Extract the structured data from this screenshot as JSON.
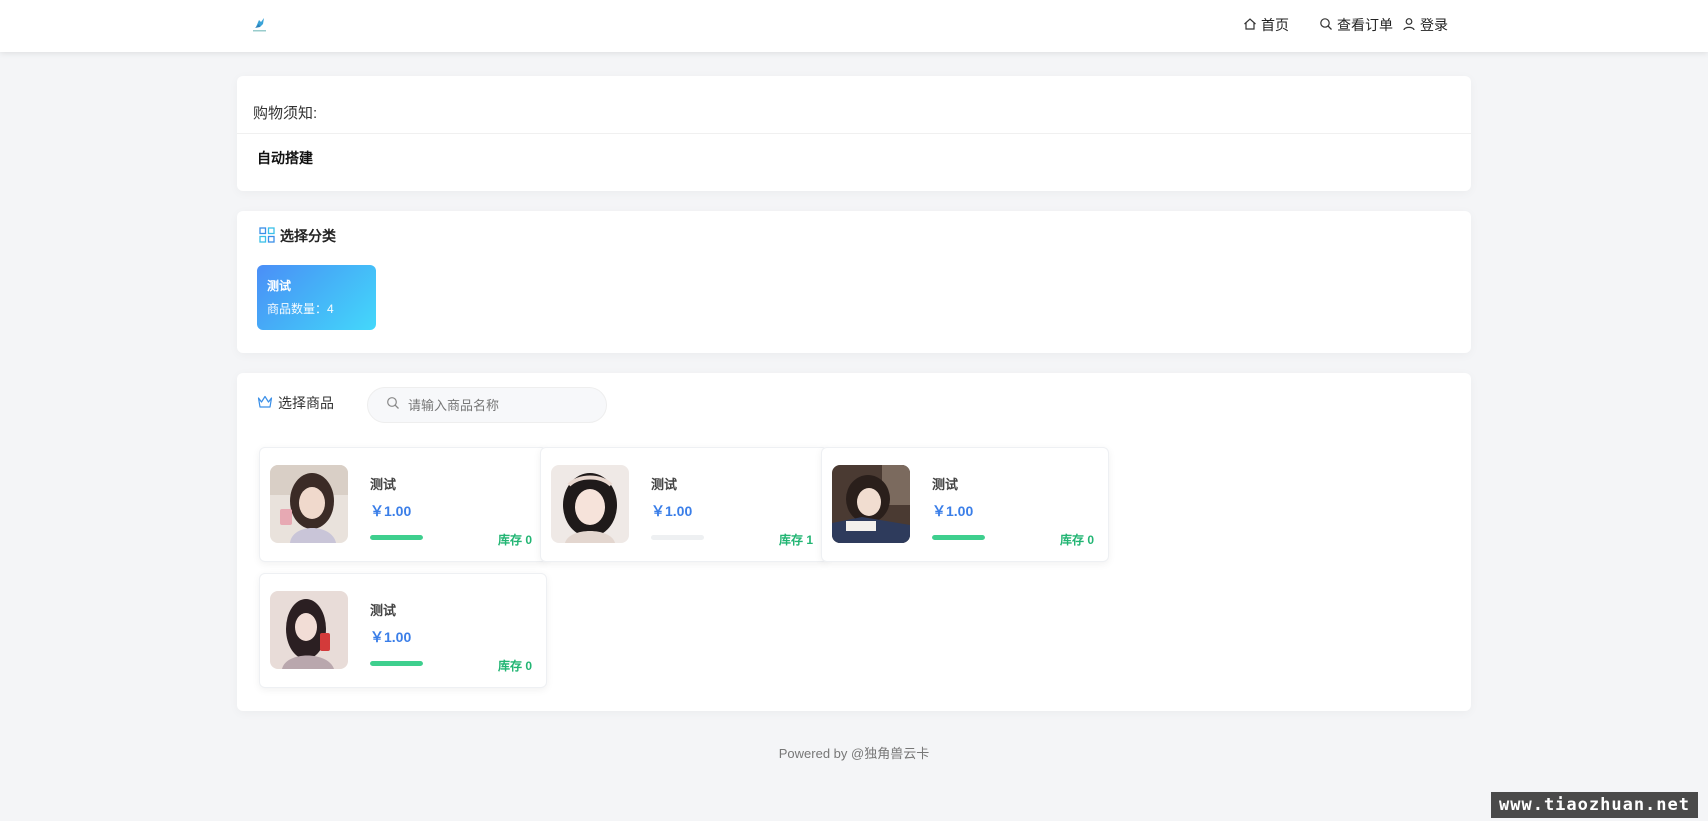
{
  "header": {
    "logo": "unicorn-logo",
    "nav": [
      {
        "label": "首页",
        "icon": "home-icon"
      },
      {
        "label": "查看订单",
        "icon": "search-icon"
      },
      {
        "label": "登录",
        "icon": "user-icon"
      }
    ]
  },
  "notice": {
    "title": "购物须知:",
    "body": "自动搭建"
  },
  "category_section": {
    "title": "选择分类",
    "icon": "grid-icon",
    "categories": [
      {
        "name": "测试",
        "count_label": "商品数量：4"
      }
    ]
  },
  "products_section": {
    "title": "选择商品",
    "icon": "crown-icon",
    "search_placeholder": "请输入商品名称",
    "products": [
      {
        "name": "测试",
        "price": "￥1.00",
        "stock": "库存 0",
        "stock_fill": 1.0
      },
      {
        "name": "测试",
        "price": "￥1.00",
        "stock": "库存 1",
        "stock_fill": 0.0
      },
      {
        "name": "测试",
        "price": "￥1.00",
        "stock": "库存 0",
        "stock_fill": 1.0
      },
      {
        "name": "测试",
        "price": "￥1.00",
        "stock": "库存 0",
        "stock_fill": 1.0
      }
    ]
  },
  "footer": {
    "text": "Powered by @独角兽云卡"
  },
  "watermark": "www.tiaozhuan.net",
  "colors": {
    "accent": "#3a7ee8",
    "stock_green": "#22b573",
    "bar_green": "#3ecf8e"
  }
}
